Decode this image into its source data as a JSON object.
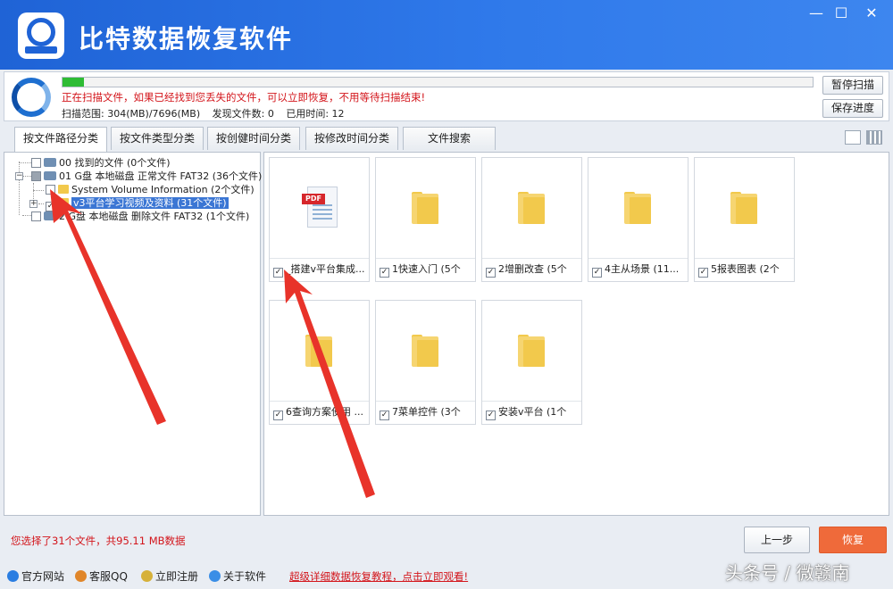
{
  "app": {
    "title": "比特数据恢复软件"
  },
  "window": {
    "minimize": "—",
    "maximize": "☐",
    "close": "✕"
  },
  "scan": {
    "progress_fraction": 0.028,
    "message": "正在扫描文件，如果已经找到您丢失的文件，可以立即恢复，不用等待扫描结束!",
    "range": "扫描范围: 304(MB)/7696(MB)",
    "found": "发现文件数: 0",
    "elapsed": "已用时间: 12",
    "pause_label": "暂停扫描",
    "save_label": "保存进度"
  },
  "tabs": [
    {
      "label": "按文件路径分类",
      "active": true
    },
    {
      "label": "按文件类型分类",
      "active": false
    },
    {
      "label": "按创健时间分类",
      "active": false
    },
    {
      "label": "按修改时间分类",
      "active": false
    },
    {
      "label": "文件搜索",
      "active": false
    }
  ],
  "tree": [
    {
      "label": "00 找到的文件 (0个文件)",
      "checked": false
    },
    {
      "label": "01 G盘 本地磁盘 正常文件 FAT32 (36个文件)",
      "checked": true
    },
    {
      "label": "System Volume Information    (2个文件)",
      "checked": false
    },
    {
      "label": "v3平台学习视频及资料    (31个文件)",
      "checked": true
    },
    {
      "label": "2 G盘 本地磁盘 删除文件 FAT32 (1个文件)",
      "checked": false
    }
  ],
  "files": [
    {
      "name": "_搭建v平台集成...",
      "type": "pdf",
      "checked": true
    },
    {
      "name": "1快速入门 (5个",
      "type": "folder",
      "checked": true
    },
    {
      "name": "2增删改查 (5个",
      "type": "folder",
      "checked": true
    },
    {
      "name": "4主从场景 (11...",
      "type": "folder",
      "checked": true
    },
    {
      "name": "5报表图表 (2个",
      "type": "folder",
      "checked": true
    },
    {
      "name": "6查询方案使用 ...",
      "type": "folder",
      "checked": true
    },
    {
      "name": "7菜单控件 (3个",
      "type": "folder",
      "checked": true
    },
    {
      "name": "安装v平台 (1个",
      "type": "folder",
      "checked": true
    }
  ],
  "pdf_tag": "PDF",
  "status": {
    "selection": "您选择了31个文件，共95.11 MB数据"
  },
  "buttons": {
    "prev": "上一步",
    "recover": "恢复"
  },
  "links": [
    {
      "label": "官方网站",
      "color": "#2a7de1"
    },
    {
      "label": "客服QQ",
      "color": "#e0862a"
    },
    {
      "label": "立即注册",
      "color": "#d6b13a"
    },
    {
      "label": "关于软件",
      "color": "#3a8ee6"
    }
  ],
  "promo": "超级详细数据恢复教程，点击立即观看!",
  "watermark": "头条号 / 微赣南",
  "colors": {
    "accent": "#2f79ea",
    "recover": "#ef6a3a",
    "alert": "#d3151b",
    "arrow": "#e8332a"
  }
}
